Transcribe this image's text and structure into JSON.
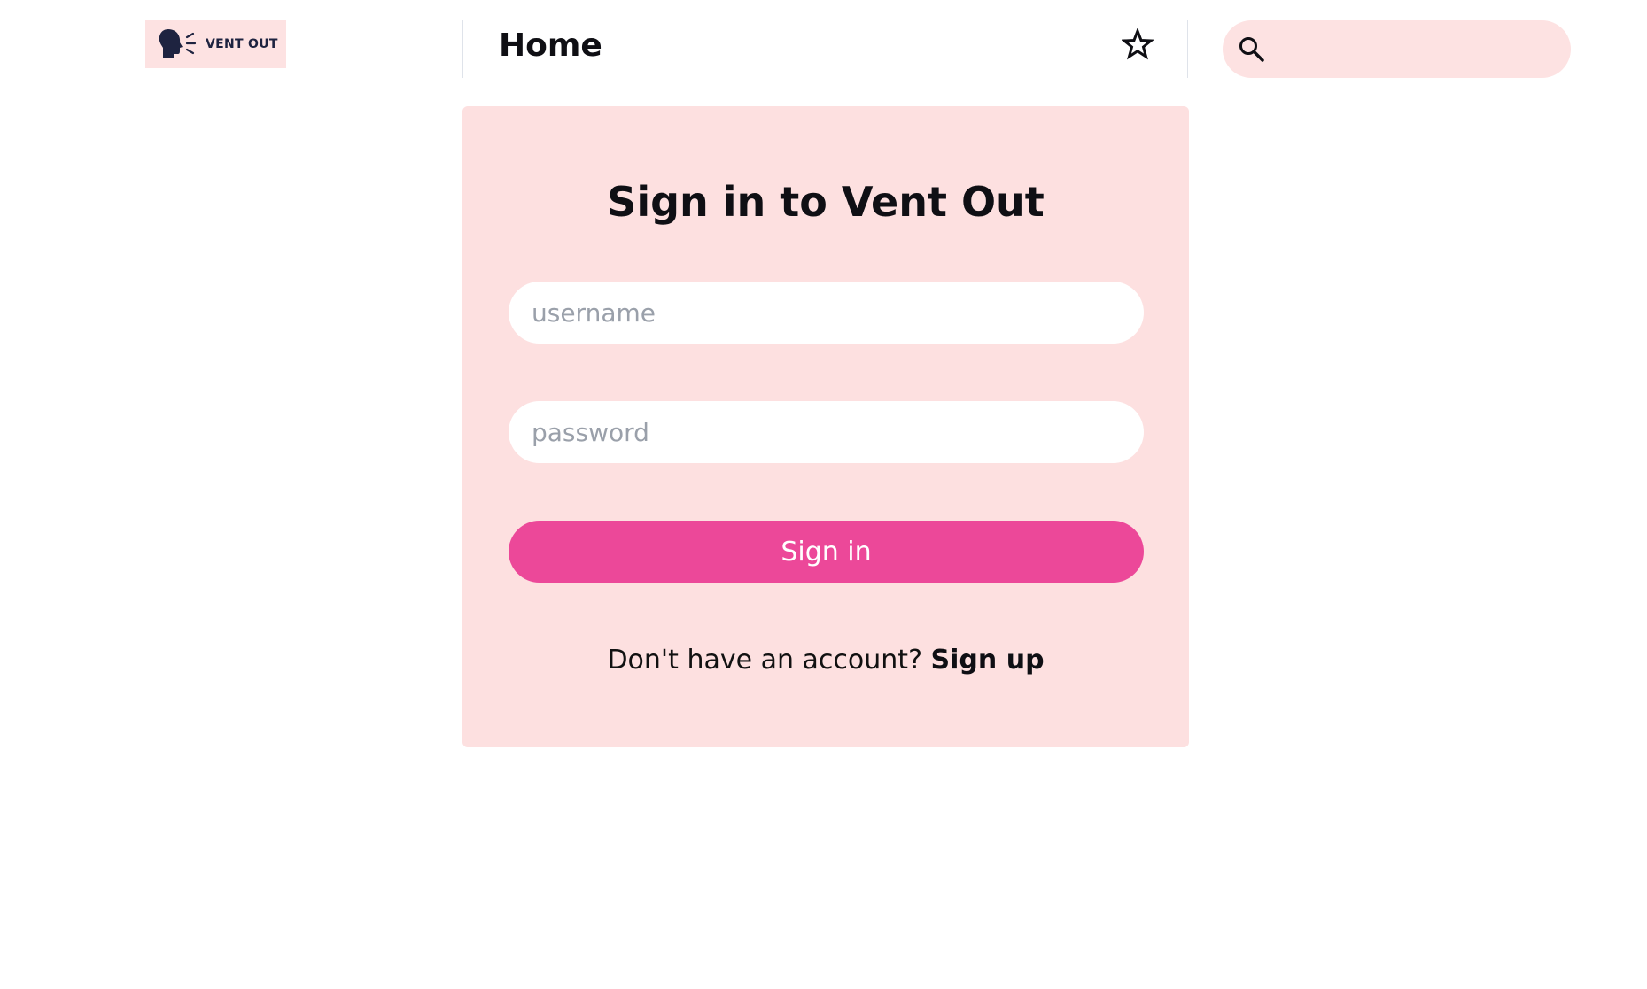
{
  "brand": {
    "logo_text": "VENT OUT",
    "logo_icon": "speaking-head-icon",
    "logo_bg": "#fde2e2"
  },
  "header": {
    "title": "Home",
    "star_icon": "star-icon"
  },
  "search": {
    "icon": "search-icon",
    "placeholder": "",
    "value": "",
    "bg": "#fde2e2"
  },
  "signin": {
    "title": "Sign in to Vent Out",
    "username_placeholder": "username",
    "password_placeholder": "password",
    "submit_label": "Sign in",
    "no_account_text": "Don't have an account?",
    "signup_link_label": "Sign up",
    "card_bg": "#fde0e0",
    "accent": "#ec4899"
  }
}
